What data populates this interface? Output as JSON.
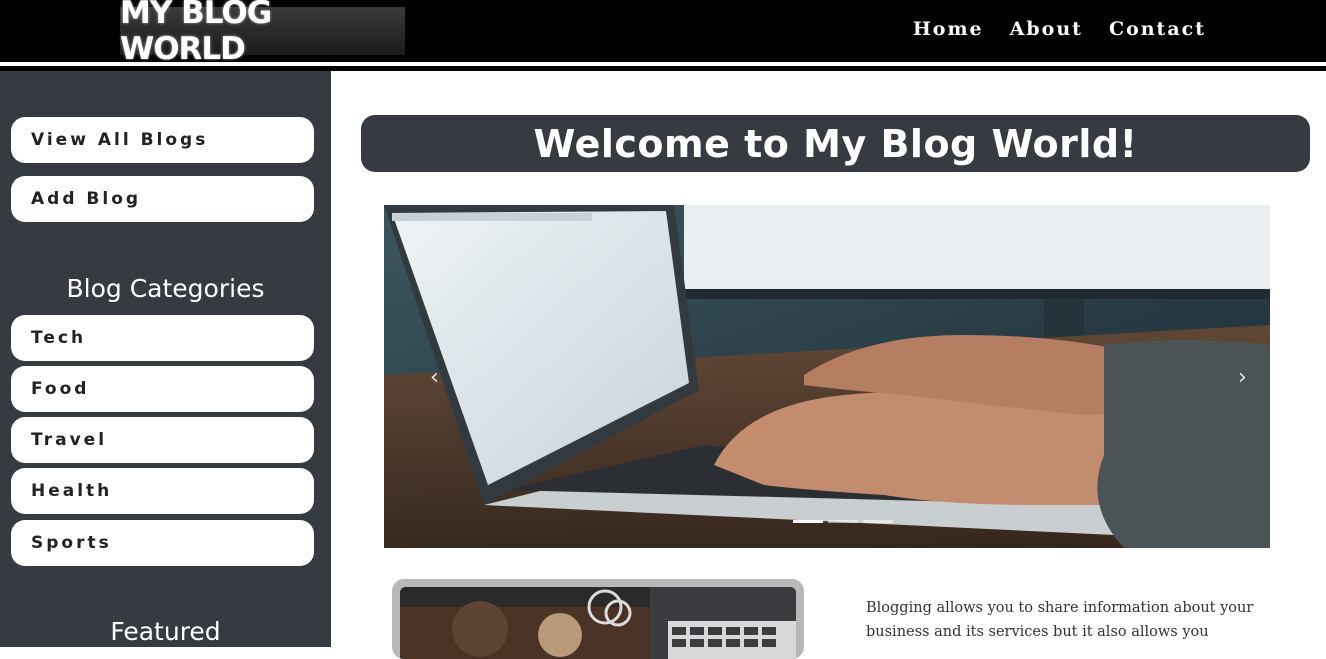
{
  "header": {
    "logo_text": "MY BLOG WORLD",
    "nav": [
      "Home",
      "About",
      "Contact"
    ]
  },
  "sidebar": {
    "actions": [
      "View All Blogs",
      "Add Blog"
    ],
    "categories_title": "Blog Categories",
    "categories": [
      "Tech",
      "Food",
      "Travel",
      "Health",
      "Sports"
    ],
    "featured_title": "Featured"
  },
  "main": {
    "welcome": "Welcome to My Blog World!",
    "carousel": {
      "prev_icon": "chevron-left-icon",
      "next_icon": "chevron-right-icon",
      "slide_count": 3,
      "active_slide": 1
    },
    "blurb": "Blogging allows you to share information about your business and its services but it also allows you"
  },
  "colors": {
    "header_bg": "#000000",
    "sidebar_bg": "#363b42",
    "banner_bg": "#363b42",
    "button_bg": "#ffffff"
  }
}
